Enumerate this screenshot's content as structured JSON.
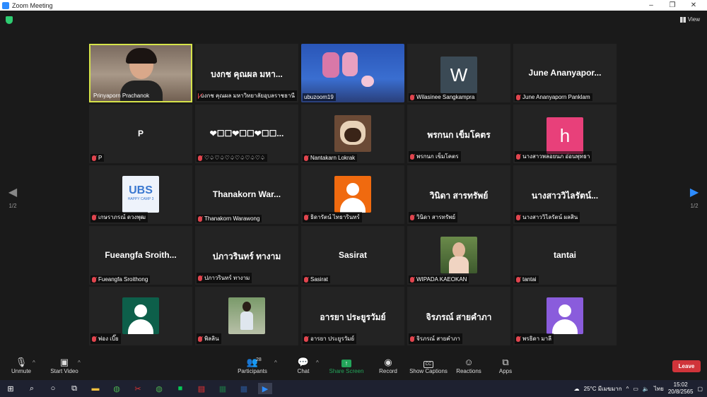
{
  "window": {
    "title": "Zoom Meeting",
    "minimize": "–",
    "maximize": "❐",
    "close": "✕"
  },
  "view_label": "View",
  "pagination": {
    "prev": "1/2",
    "next": "1/2"
  },
  "tiles": [
    {
      "big": "",
      "label": "Prinyaporn Prachanok",
      "muted": false
    },
    {
      "big": "บงกช คุณผล มหา...",
      "label": "บงกช คุณผล มหาวิทยาลัยอุบลราชธานี",
      "muted": true
    },
    {
      "big": "",
      "label": "ubuzoom19",
      "muted": false
    },
    {
      "big": "",
      "label": "Wilasinee Sangkampra",
      "muted": true,
      "avatar_letter": "W"
    },
    {
      "big": "June Ananyapor...",
      "label": "June Ananyaporn Panklam",
      "muted": true
    },
    {
      "big": "P",
      "label": "P",
      "muted": true
    },
    {
      "big": "❤☐☐❤☐☐❤☐☐...",
      "label": "♡♤♡♤♡♤♡♤♡♤♡♤",
      "muted": true
    },
    {
      "big": "",
      "label": "Nantakarn Lokrak",
      "muted": true
    },
    {
      "big": "พรกนก เข็มโคตร",
      "label": "พรกนก เข็มโคตร",
      "muted": true
    },
    {
      "big": "",
      "label": "นางสาวพลอยนภ อ่อนพุทธา",
      "muted": true,
      "avatar_letter": "h"
    },
    {
      "big": "",
      "label": "เกษราภรณ์ ดวงพุฒ",
      "muted": true,
      "logo_text": "UBS",
      "logo_sub": "HAPPY CAMP 3"
    },
    {
      "big": "Thanakorn War...",
      "label": "Thanakorn Warawong",
      "muted": true
    },
    {
      "big": "",
      "label": "ธิดารัตน์ ไทธารินทร์",
      "muted": true
    },
    {
      "big": "วินิดา สารทรัพย์",
      "label": "วินิดา สารทรัพย์",
      "muted": true
    },
    {
      "big": "นางสาววิไลรัตน์...",
      "label": "นางสาววิไลรัตน์ ผลสิน",
      "muted": true
    },
    {
      "big": "Fueangfa Sroith...",
      "label": "Fueangfa Sroithong",
      "muted": true
    },
    {
      "big": "ปภาวรินทร์ ทางาม",
      "label": "ปภาวรินทร์ ทางาม",
      "muted": true
    },
    {
      "big": "Sasirat",
      "label": "Sasirat",
      "muted": true
    },
    {
      "big": "",
      "label": "WIPADA KAEOKAN",
      "muted": true
    },
    {
      "big": "tantai",
      "label": "tantai",
      "muted": true
    },
    {
      "big": "",
      "label": "พ่อง เบิ๊ย",
      "muted": true
    },
    {
      "big": "",
      "label": "พิลลิน",
      "muted": true
    },
    {
      "big": "อารยา ประยูรวัมย์",
      "label": "อารยา ประยูรวัมย์",
      "muted": true
    },
    {
      "big": "จิรภรณ์ สายคำภา",
      "label": "จิรภรณ์ สายคำภา",
      "muted": true
    },
    {
      "big": "",
      "label": "พรธิดา มาลี",
      "muted": true
    }
  ],
  "toolbar": {
    "unmute": "Unmute",
    "start_video": "Start Video",
    "participants": "Participants",
    "participants_count": "28",
    "chat": "Chat",
    "share_screen": "Share Screen",
    "record": "Record",
    "show_captions": "Show Captions",
    "captions_icon": "CC",
    "reactions": "Reactions",
    "apps": "Apps",
    "leave": "Leave"
  },
  "taskbar": {
    "weather": "25°C มีเมฆมาก",
    "language": "ไทย",
    "time": "15:02",
    "date": "20/8/2565"
  },
  "colors": {
    "active_speaker_border": "#d6e34a",
    "leave_button": "#d0343a",
    "share_screen": "#23a55a",
    "nav_arrow_left": "#888888",
    "nav_arrow_right": "#2d8cff",
    "avatar_w": "#3b4a55",
    "avatar_h": "#e8407a",
    "avatar_orange": "#f06a0f",
    "avatar_green": "#0d5f4a",
    "avatar_purple": "#8a5cdc"
  }
}
